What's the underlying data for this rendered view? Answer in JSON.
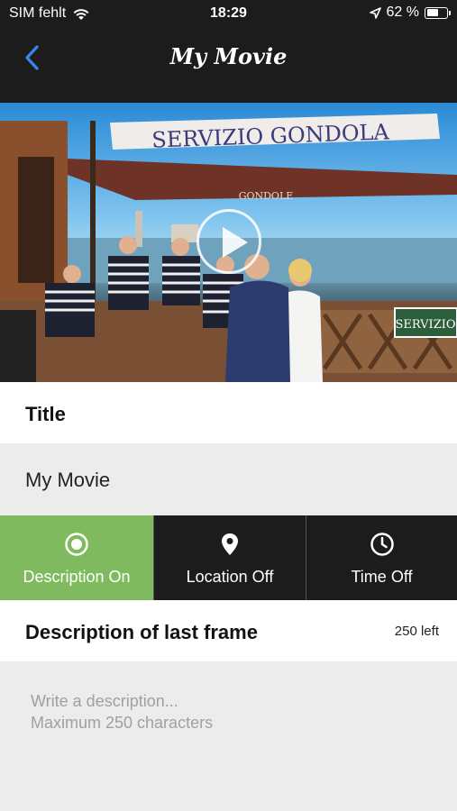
{
  "status_bar": {
    "carrier": "SIM fehlt",
    "time": "18:29",
    "battery_percent": "62 %",
    "battery_level": 0.62
  },
  "nav": {
    "title": "My Movie",
    "back_icon": "chevron-left-icon"
  },
  "video": {
    "banner_text": "SERVIZIO GONDOLA",
    "awning_text": "GONDOLE",
    "sign_text": "SERVIZIO",
    "play_icon": "play-icon"
  },
  "title_section": {
    "label": "Title",
    "value": "My Movie"
  },
  "toggles": [
    {
      "label": "Description On",
      "icon": "radio-on-icon",
      "active": true,
      "color": "#7fbb5e"
    },
    {
      "label": "Location Off",
      "icon": "location-pin-icon",
      "active": false,
      "color": "#1c1c1c"
    },
    {
      "label": "Time Off",
      "icon": "clock-icon",
      "active": false,
      "color": "#1c1c1c"
    }
  ],
  "description_section": {
    "label": "Description of last frame",
    "remaining": "250 left",
    "placeholder": "Write a description...\nMaximum 250 characters"
  }
}
